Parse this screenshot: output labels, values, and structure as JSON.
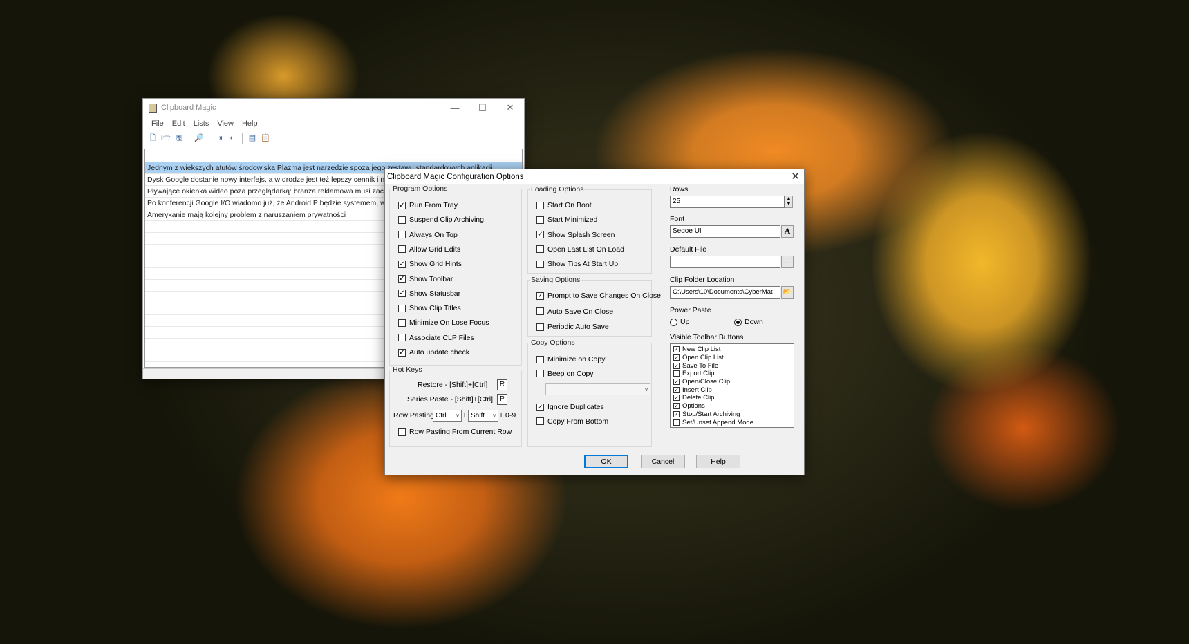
{
  "main_window": {
    "title": "Clipboard Magic",
    "menu": [
      "File",
      "Edit",
      "Lists",
      "View",
      "Help"
    ],
    "clips": [
      "Jednym z większych atutów środowiska Plazma jest narzędzie spoza jego zestawu standardowych aplikacji",
      "Dysk Google dostanie nowy interfejs, a w drodze jest też lepszy cennik i no",
      "Pływające okienka wideo poza przeglądarką: branża reklamowa musi zacier",
      "Po konferencji Google I/O wiadomo już, że Android P będzie systemem, w k",
      "Amerykanie mają kolejny problem z naruszaniem prywatności"
    ]
  },
  "dialog": {
    "title": "Clipboard Magic Configuration Options",
    "program_options": {
      "title": "Program Options",
      "items": [
        {
          "label": "Run From Tray",
          "checked": true
        },
        {
          "label": "Suspend Clip Archiving",
          "checked": false
        },
        {
          "label": "Always On Top",
          "checked": false
        },
        {
          "label": "Allow Grid Edits",
          "checked": false
        },
        {
          "label": "Show Grid Hints",
          "checked": true
        },
        {
          "label": "Show Toolbar",
          "checked": true
        },
        {
          "label": "Show Statusbar",
          "checked": true
        },
        {
          "label": "Show Clip Titles",
          "checked": false
        },
        {
          "label": "Minimize On Lose Focus",
          "checked": false
        },
        {
          "label": "Associate CLP Files",
          "checked": false
        },
        {
          "label": "Auto update check",
          "checked": true
        }
      ]
    },
    "hot_keys": {
      "title": "Hot Keys",
      "restore_label": "Restore - [Shift]+[Ctrl]",
      "restore_key": "R",
      "series_label": "Series Paste - [Shift]+[Ctrl]",
      "series_key": "P",
      "row_pasting_label": "Row Pasting",
      "row_mod1": "Ctrl",
      "plus": "+",
      "row_mod2": "Shift",
      "row_suffix": "+ 0-9",
      "from_current_row": {
        "label": "Row Pasting From Current Row",
        "checked": false
      }
    },
    "loading_options": {
      "title": "Loading Options",
      "items": [
        {
          "label": "Start On Boot",
          "checked": false
        },
        {
          "label": "Start Minimized",
          "checked": false
        },
        {
          "label": "Show Splash Screen",
          "checked": true
        },
        {
          "label": "Open Last List On Load",
          "checked": false
        },
        {
          "label": "Show Tips At Start Up",
          "checked": false
        }
      ]
    },
    "saving_options": {
      "title": "Saving Options",
      "items": [
        {
          "label": "Prompt to Save Changes On Close",
          "checked": true
        },
        {
          "label": "Auto Save On Close",
          "checked": false
        },
        {
          "label": "Periodic Auto Save",
          "checked": false
        }
      ]
    },
    "copy_options": {
      "title": "Copy Options",
      "items": [
        {
          "label": "Minimize on Copy",
          "checked": false
        },
        {
          "label": "Beep on Copy",
          "checked": false
        }
      ],
      "items2": [
        {
          "label": "Ignore Duplicates",
          "checked": true
        },
        {
          "label": "Copy From Bottom",
          "checked": false
        }
      ]
    },
    "rows": {
      "title": "Rows",
      "value": "25"
    },
    "font": {
      "title": "Font",
      "value": "Segoe UI",
      "button": "A"
    },
    "default_file": {
      "title": "Default File",
      "value": "",
      "button": "..."
    },
    "clip_folder": {
      "title": "Clip Folder Location",
      "value": "C:\\Users\\10\\Documents\\CyberMat"
    },
    "power_paste": {
      "title": "Power Paste",
      "up": "Up",
      "down": "Down",
      "selected": "Down"
    },
    "toolbar_buttons": {
      "title": "Visible Toolbar Buttons",
      "items": [
        {
          "label": "New Clip List",
          "checked": true
        },
        {
          "label": "Open Clip List",
          "checked": true
        },
        {
          "label": "Save To File",
          "checked": true
        },
        {
          "label": "Export Clip",
          "checked": false
        },
        {
          "label": "Open/Close Clip",
          "checked": true
        },
        {
          "label": "Insert Clip",
          "checked": true
        },
        {
          "label": "Delete Clip",
          "checked": true
        },
        {
          "label": "Options",
          "checked": true
        },
        {
          "label": "Stop/Start Archiving",
          "checked": true
        },
        {
          "label": "Set/Unset Append Mode",
          "checked": false
        }
      ]
    },
    "buttons": {
      "ok": "OK",
      "cancel": "Cancel",
      "help": "Help"
    }
  }
}
